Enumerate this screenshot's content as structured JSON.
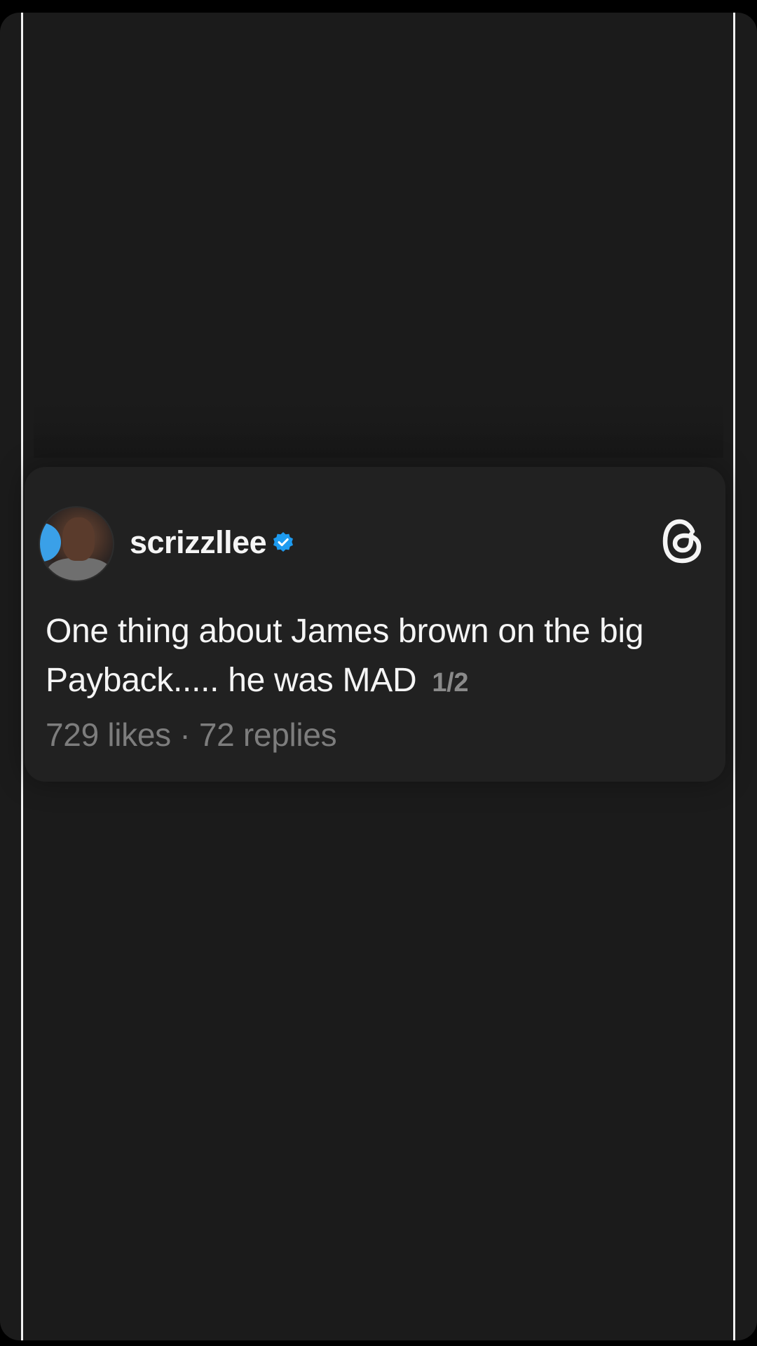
{
  "post": {
    "username": "scrizzllee",
    "text": "One thing about James brown on the big Payback..... he was MAD",
    "page_indicator": "1/2",
    "likes": "729 likes",
    "separator": "·",
    "replies": "72 replies"
  },
  "icons": {
    "verified": "verified-badge-icon",
    "brand": "threads-logo-icon"
  },
  "colors": {
    "background": "#1b1b1b",
    "card": "#212121",
    "verified_blue": "#1d9bf0",
    "text": "#f5f5f5",
    "muted": "#7d7d7d"
  }
}
